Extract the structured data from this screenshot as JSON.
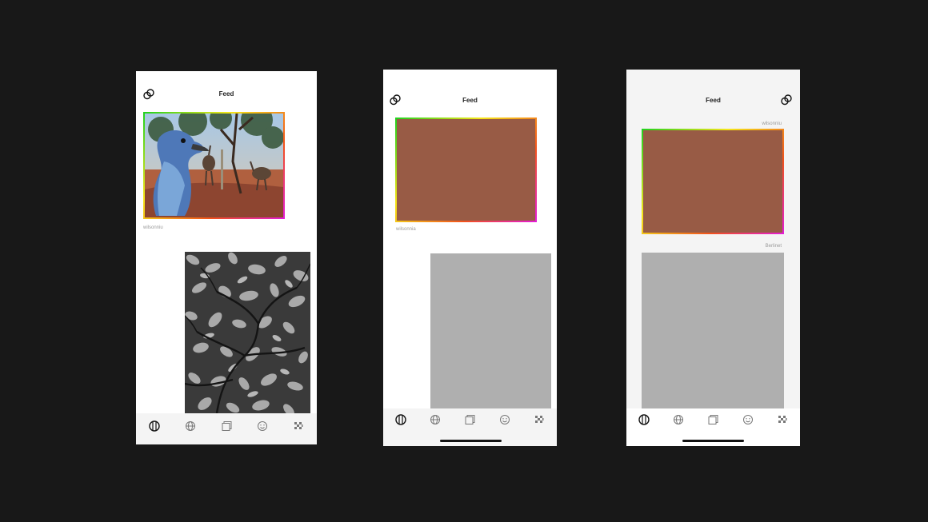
{
  "colors": {
    "background": "#181818",
    "placeholder_brown": "#985b45",
    "placeholder_grey": "#afafaf",
    "gradient": [
      "#1fd11f",
      "#f5e61a",
      "#f2521c",
      "#e41bd9"
    ]
  },
  "screens": [
    {
      "title": "Feed",
      "posts": [
        {
          "user": "wilsonniu",
          "image": "emu-photo"
        },
        {
          "user": "",
          "image": "leaves-photo"
        }
      ],
      "tabs": [
        "feed-icon",
        "globe-icon",
        "gallery-icon",
        "smiley-icon",
        "pixel-grid-icon"
      ]
    },
    {
      "title": "Feed",
      "posts": [
        {
          "user": "wilsonnia",
          "image": "placeholder-brown"
        },
        {
          "user": "",
          "image": "placeholder-grey"
        }
      ],
      "tabs": [
        "feed-icon",
        "globe-icon",
        "gallery-icon",
        "smiley-icon",
        "pixel-grid-icon"
      ]
    },
    {
      "title": "Feed",
      "posts": [
        {
          "user": "wilsonniu",
          "image": "placeholder-brown"
        },
        {
          "user": "Berlinet",
          "image": "placeholder-grey"
        }
      ],
      "tabs": [
        "feed-icon",
        "globe-icon",
        "gallery-icon",
        "smiley-icon",
        "pixel-grid-icon"
      ]
    }
  ]
}
